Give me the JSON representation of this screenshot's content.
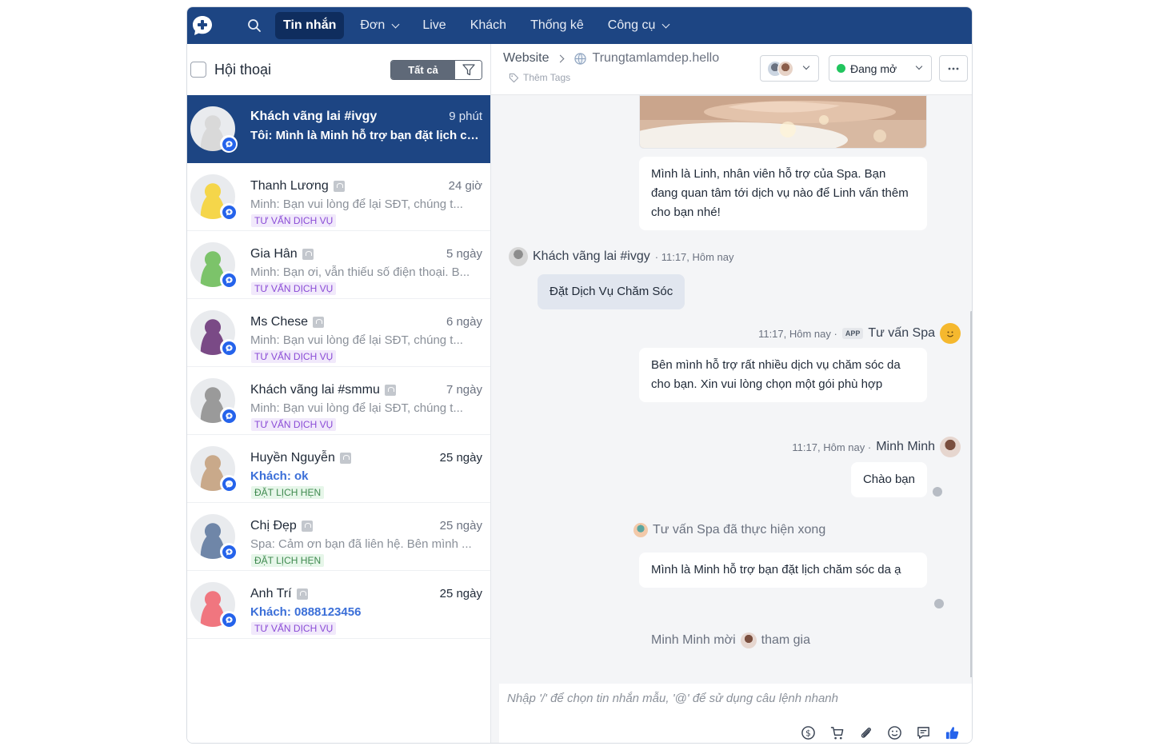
{
  "nav": {
    "items": [
      {
        "label": "Tin nhắn",
        "active": true
      },
      {
        "label": "Đơn",
        "dropdown": true
      },
      {
        "label": "Live"
      },
      {
        "label": "Khách"
      },
      {
        "label": "Thống kê"
      },
      {
        "label": "Công cụ",
        "dropdown": true
      }
    ]
  },
  "sidebar": {
    "title": "Hội thoại",
    "filter_label": "Tất cả",
    "conversations": [
      {
        "name": "Khách vãng lai #ivgy",
        "time": "9 phút",
        "preview": "Tôi: Mình là Minh hỗ trợ bạn đặt lịch ch...",
        "tag": "",
        "channel": "livechat",
        "avatar_color": "#d9d9d9",
        "active": true
      },
      {
        "name": "Thanh Lương",
        "time": "24 giờ",
        "preview": "Minh: Bạn vui lòng để lại SĐT, chúng t...",
        "tag": "TƯ VẤN DỊCH VỤ",
        "tag_color": "purple",
        "channel": "livechat",
        "avatar_color": "#f5d64a"
      },
      {
        "name": "Gia Hân",
        "time": "5 ngày",
        "preview": "Minh: Bạn ơi, vẫn thiếu số điện thoại. B...",
        "tag": "TƯ VẤN DỊCH VỤ",
        "tag_color": "purple",
        "channel": "livechat",
        "avatar_color": "#7cc36a"
      },
      {
        "name": "Ms Chese",
        "time": "6 ngày",
        "preview": "Minh: Bạn vui lòng để lại SĐT, chúng t...",
        "tag": "TƯ VẤN DỊCH VỤ",
        "tag_color": "purple",
        "channel": "livechat",
        "avatar_color": "#7a4a86"
      },
      {
        "name": "Khách vãng lai #smmu",
        "time": "7 ngày",
        "preview": "Minh: Bạn vui lòng để lại SĐT, chúng t...",
        "tag": "TƯ VẤN DỊCH VỤ",
        "tag_color": "purple",
        "channel": "livechat",
        "avatar_color": "#9a9a9a"
      },
      {
        "name": "Huyền Nguyễn",
        "time": "25 ngày",
        "preview": "Khách: ok",
        "tag": "ĐẶT LỊCH HẸN",
        "tag_color": "green",
        "channel": "messenger",
        "avatar_color": "#c9a98a",
        "unread": true
      },
      {
        "name": "Chị Đẹp",
        "time": "25 ngày",
        "preview": "Spa: Cảm ơn bạn đã liên hệ. Bên mình ...",
        "tag": "ĐẶT LỊCH HẸN",
        "tag_color": "green",
        "channel": "livechat",
        "avatar_color": "#6f86a8"
      },
      {
        "name": "Anh Trí",
        "time": "25 ngày",
        "preview": "Khách: 0888123456",
        "tag": "TƯ VẤN DỊCH VỤ",
        "tag_color": "purple",
        "channel": "livechat",
        "avatar_color": "#f0767f",
        "unread": true
      }
    ]
  },
  "chat": {
    "source": "Website",
    "page_name": "Trungtamlamdep.hello",
    "add_tags": "Thêm Tags",
    "status": "Đang mở",
    "messages": {
      "bot_intro": "Mình là Linh, nhân viên hỗ trợ của Spa. Bạn đang quan tâm tới dịch vụ nào để Linh vấn thêm cho bạn nhé!",
      "customer_name": "Khách vãng lai #ivgy",
      "customer_time": "· 11:17, Hôm nay",
      "customer_msg": "Đặt Dịch Vụ Chăm Sóc",
      "bot_time": "11:17, Hôm nay ·",
      "bot_badge": "APP",
      "bot_name": "Tư vấn Spa",
      "bot_msg": "Bên mình hỗ trợ rất nhiều dịch vụ chăm sóc da cho bạn. Xin vui lòng chọn một gói phù hợp",
      "agent_time": "11:17, Hôm nay ·",
      "agent_name": "Minh Minh",
      "agent_msg": "Chào bạn",
      "system_done": "Tư vấn Spa đã thực hiện xong",
      "agent_msg2": "Mình là Minh hỗ trợ bạn đặt lịch chăm sóc da ạ",
      "join_prefix": "Minh Minh mời",
      "join_suffix": "tham gia"
    },
    "composer_placeholder": "Nhập '/' để chọn tin nhắn mẫu, '@' để sử dụng câu lệnh nhanh"
  },
  "colors": {
    "nav_bg": "#1d4583",
    "active_row": "#1d4583",
    "accent": "#2563eb",
    "status_green": "#22c55e"
  }
}
